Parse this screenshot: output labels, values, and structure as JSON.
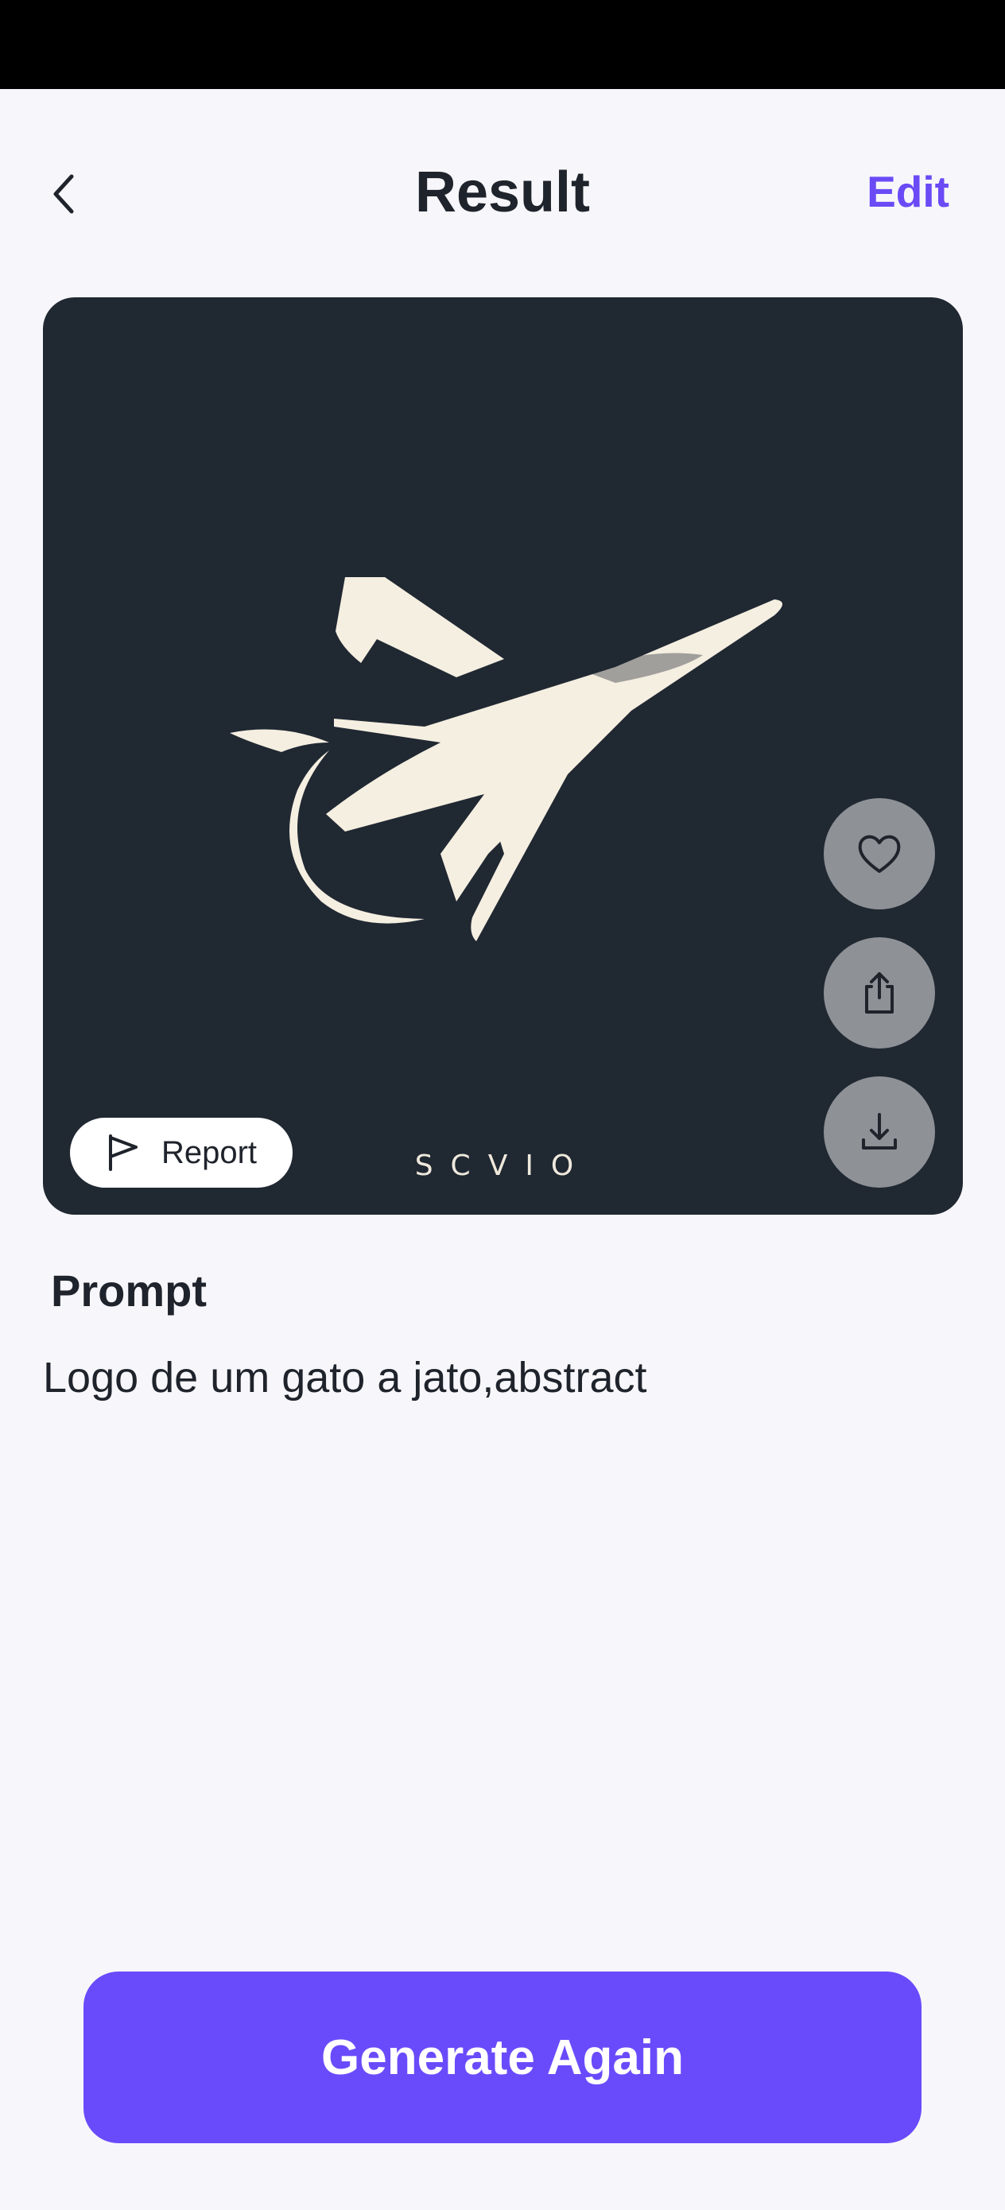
{
  "header": {
    "title": "Result",
    "edit_label": "Edit"
  },
  "image": {
    "watermark": "SCVIO",
    "report_label": "Report",
    "background_color": "#202832",
    "art_color": "#f5efe1",
    "actions": [
      "heart-icon",
      "share-icon",
      "download-icon"
    ]
  },
  "prompt": {
    "heading": "Prompt",
    "text": "Logo de um gato a jato,abstract"
  },
  "footer": {
    "generate_label": "Generate Again"
  },
  "colors": {
    "accent": "#6a4bf5",
    "button": "#6a4bfb",
    "page_background": "#f7f7fb"
  }
}
